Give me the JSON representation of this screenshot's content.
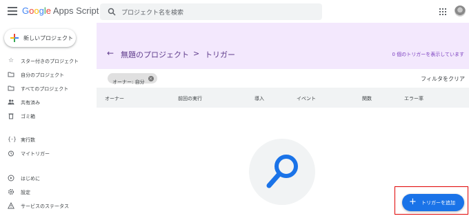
{
  "header": {
    "logo": {
      "google": "Google",
      "apps_script": " Apps Script"
    },
    "search_placeholder": "プロジェクト名を検索"
  },
  "sidebar": {
    "new_project_label": "新しいプロジェクト",
    "items": [
      {
        "label": "スター付きのプロジェクト",
        "icon": "star-icon"
      },
      {
        "label": "自分のプロジェクト",
        "icon": "folder-icon"
      },
      {
        "label": "すべてのプロジェクト",
        "icon": "folder-icon"
      },
      {
        "label": "共有済み",
        "icon": "people-icon"
      },
      {
        "label": "ゴミ箱",
        "icon": "trash-icon"
      },
      {
        "label": "実行数",
        "icon": "executions-icon"
      },
      {
        "label": "マイトリガー",
        "icon": "alarm-icon"
      },
      {
        "label": "はじめに",
        "icon": "play-icon"
      },
      {
        "label": "設定",
        "icon": "gear-icon"
      },
      {
        "label": "サービスのステータス",
        "icon": "warning-icon"
      }
    ]
  },
  "page": {
    "breadcrumb_project": "無題のプロジェクト",
    "breadcrumb_separator": ">",
    "breadcrumb_current": "トリガー",
    "trigger_count_text": "0 個のトリガーを表示しています",
    "filter_chip": "オーナー: 自分",
    "clear_filter": "フィルタをクリア"
  },
  "table": {
    "columns": [
      "オーナー",
      "前回の実行",
      "導入",
      "イベント",
      "関数",
      "エラー率"
    ]
  },
  "fab": {
    "label": "トリガーを追加",
    "icon": "plus"
  },
  "colors": {
    "header_bg": "#f3e8fd",
    "accent_purple": "#5f3c8c",
    "fab_blue": "#1a73e8",
    "highlight_red": "#e00000"
  }
}
